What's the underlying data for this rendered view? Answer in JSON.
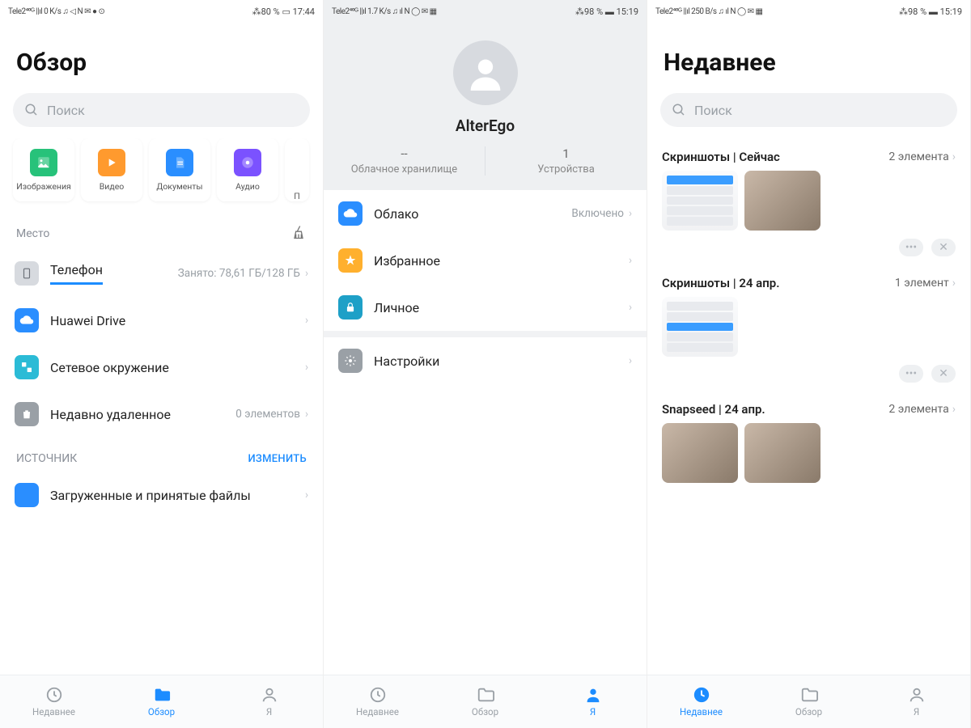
{
  "statusA": {
    "left": "Tele2⁴⁰ᴳ ||ıl 0 K/s ♫ ◁ N ✉ ● ⊙",
    "right": "⁂80 % ▭ 17:44"
  },
  "statusB": {
    "left": "Tele2⁴⁰ᴳ ||ıl 1.7 K/s ♫ ıl N ◯ ✉ ▦",
    "right": "⁂98 % ▬ 15:19"
  },
  "statusC": {
    "left": "Tele2⁴⁰ᴳ ||ıl 250 B/s ♫ ıl N ◯ ✉ ▦",
    "right": "⁂98 % ▬ 15:19"
  },
  "paneA": {
    "title": "Обзор",
    "search_placeholder": "Поиск",
    "cats": [
      {
        "label": "Изображения"
      },
      {
        "label": "Видео"
      },
      {
        "label": "Документы"
      },
      {
        "label": "Аудио"
      },
      {
        "label": "П"
      }
    ],
    "section_place": "Место",
    "storage": {
      "label": "Телефон",
      "detail": "Занято: 78,61 ГБ/128 ГБ"
    },
    "drive": "Huawei Drive",
    "network": "Сетевое окружение",
    "deleted": {
      "label": "Недавно удаленное",
      "detail": "0 элементов"
    },
    "section_source": "ИСТОЧНИК",
    "change": "ИЗМЕНИТЬ",
    "downloads": "Загруженные и принятые файлы"
  },
  "paneB": {
    "name": "AlterEgo",
    "cloud_stat_value": "--",
    "cloud_stat_label": "Облачное хранилище",
    "dev_stat_value": "1",
    "dev_stat_label": "Устройства",
    "cloud": {
      "label": "Облако",
      "state": "Включено"
    },
    "fav": "Избранное",
    "personal": "Личное",
    "settings": "Настройки"
  },
  "paneC": {
    "title": "Недавнее",
    "search_placeholder": "Поиск",
    "groups": [
      {
        "heading": "Скриншоты | Сейчас",
        "count": "2 элемента"
      },
      {
        "heading": "Скриншоты | 24 апр.",
        "count": "1 элемент"
      },
      {
        "heading": "Snapseed | 24 апр.",
        "count": "2 элемента"
      }
    ]
  },
  "nav": {
    "recent": "Недавнее",
    "overview": "Обзор",
    "me": "Я"
  }
}
